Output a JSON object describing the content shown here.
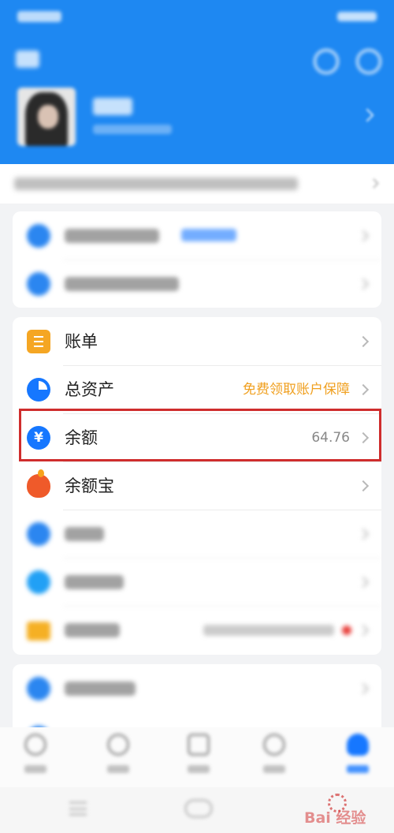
{
  "colors": {
    "header_blue": "#1e88f2",
    "accent_blue": "#1677ff",
    "promo_orange": "#f0a020",
    "highlight_red": "#cf2d2d",
    "badge_red": "#e8403c"
  },
  "menu": {
    "bill": {
      "label": "账单",
      "icon": "bill-list-icon"
    },
    "assets": {
      "label": "总资产",
      "icon": "pie-chart-icon",
      "promo": "免费领取账户保障"
    },
    "balance": {
      "label": "余额",
      "icon": "yen-coin-icon",
      "value": "64.76"
    },
    "yuebao": {
      "label": "余额宝",
      "icon": "yuebao-icon"
    }
  },
  "watermark": {
    "text": "Bai 经验"
  }
}
